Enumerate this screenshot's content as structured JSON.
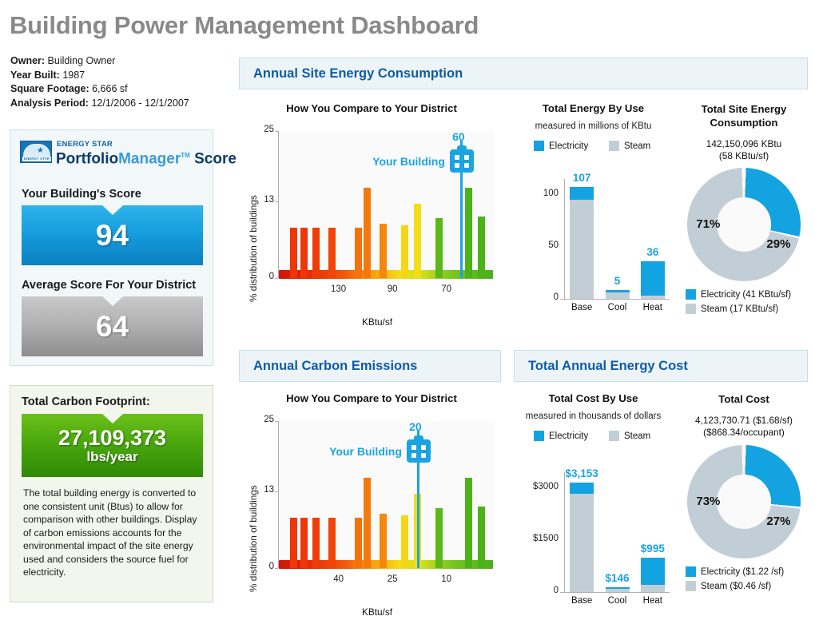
{
  "page": {
    "title": "Building Power Management Dashboard"
  },
  "meta": {
    "owner_label": "Owner:",
    "owner_value": "Building Owner",
    "year_label": "Year Built:",
    "year_value": "1987",
    "sqft_label": "Square Footage:",
    "sqft_value": "6,666 sf",
    "period_label": "Analysis Period:",
    "period_value": "12/1/2006 - 12/1/2007"
  },
  "score_panel": {
    "logo_top": "ENERGY STAR",
    "logo_mark_text": "ENERGY STAR",
    "logo_part1": "Portfolio",
    "logo_part2": "Manager",
    "logo_tm": "TM",
    "logo_part3": "Score",
    "building_score_label": "Your Building's Score",
    "building_score_value": "94",
    "district_score_label": "Average Score For Your District",
    "district_score_value": "64"
  },
  "carbon_panel": {
    "title": "Total Carbon Footprint:",
    "value": "27,109,373",
    "unit": "lbs/year",
    "description": "The total building energy is converted to one consistent unit (Btus) to allow for comparison with other buildings. Display of carbon emissions accounts for the environmental impact of the site energy used and considers the source fuel for electricity."
  },
  "sections": {
    "energy": "Annual Site Energy Consumption",
    "carbon": "Annual Carbon Emissions",
    "cost": "Total Annual Energy Cost"
  },
  "colors": {
    "electricity": "#13a3e0",
    "steam": "#c2ced5",
    "accent_blue": "#1ba4e2",
    "header_text": "#0d5ca8",
    "title_gray": "#898989",
    "carbon_green": "#4aa80d"
  },
  "chart_data": [
    {
      "id": "energy-histogram",
      "type": "bar",
      "title": "How You Compare to Your District",
      "xlabel": "KBtu/sf",
      "ylabel": "% distribution of buildings",
      "ylim": [
        0,
        25
      ],
      "yticks": [
        "0",
        "13",
        "25"
      ],
      "xticks": [
        "130",
        "90",
        "70"
      ],
      "xtick_positions": [
        0.28,
        0.53,
        0.78
      ],
      "marker_label": "Your Building",
      "marker_value": "60",
      "marker_position": 0.845,
      "bars": [
        {
          "pos": 0.055,
          "value": 8.6,
          "color": "#ee3707"
        },
        {
          "pos": 0.105,
          "value": 8.6,
          "color": "#ee3707"
        },
        {
          "pos": 0.16,
          "value": 8.6,
          "color": "#ef3d07"
        },
        {
          "pos": 0.235,
          "value": 8.6,
          "color": "#f04608"
        },
        {
          "pos": 0.355,
          "value": 8.6,
          "color": "#f4720b"
        },
        {
          "pos": 0.398,
          "value": 15.4,
          "color": "#f5780c"
        },
        {
          "pos": 0.47,
          "value": 9.2,
          "color": "#f5870d"
        },
        {
          "pos": 0.57,
          "value": 9.0,
          "color": "#f4d616"
        },
        {
          "pos": 0.63,
          "value": 12.6,
          "color": "#f2de18"
        },
        {
          "pos": 0.728,
          "value": 10.2,
          "color": "#5cb718"
        },
        {
          "pos": 0.865,
          "value": 15.4,
          "color": "#4bb217"
        },
        {
          "pos": 0.925,
          "value": 10.4,
          "color": "#4bb217"
        }
      ]
    },
    {
      "id": "energy-by-use",
      "type": "bar",
      "title": "Total Energy By Use",
      "subtitle": "measured in millions of KBtu",
      "ylim": [
        0,
        115
      ],
      "yticks": [
        "0",
        "50",
        "100"
      ],
      "categories": [
        "Base",
        "Cool",
        "Heat"
      ],
      "totals": [
        "107",
        "5",
        "36"
      ],
      "series": [
        {
          "name": "Electricity",
          "values": [
            12,
            1.6,
            33
          ]
        },
        {
          "name": "Steam",
          "values": [
            95,
            6.5,
            3
          ]
        }
      ],
      "legend": [
        "Electricity",
        "Steam"
      ]
    },
    {
      "id": "site-energy-donut",
      "type": "pie",
      "title": "Total Site Energy Consumption",
      "summary_line1": "142,150,096 KBtu",
      "summary_line2": "(58 KBtu/sf)",
      "labels": [
        "71%",
        "29%"
      ],
      "values": [
        71,
        29
      ],
      "legend": [
        "Electricity (41 KBtu/sf)",
        "Steam (17 KBtu/sf)"
      ]
    },
    {
      "id": "carbon-histogram",
      "type": "bar",
      "title": "How You Compare to Your District",
      "xlabel": "KBtu/sf",
      "ylabel": "% distribution of buildings",
      "ylim": [
        0,
        25
      ],
      "yticks": [
        "0",
        "13",
        "25"
      ],
      "xticks": [
        "40",
        "25",
        "10"
      ],
      "xtick_positions": [
        0.28,
        0.53,
        0.78
      ],
      "marker_label": "Your Building",
      "marker_value": "20",
      "marker_position": 0.645,
      "bars": [
        {
          "pos": 0.055,
          "value": 8.6,
          "color": "#ee3707"
        },
        {
          "pos": 0.105,
          "value": 8.6,
          "color": "#ee3707"
        },
        {
          "pos": 0.16,
          "value": 8.6,
          "color": "#ef3d07"
        },
        {
          "pos": 0.235,
          "value": 8.6,
          "color": "#f04608"
        },
        {
          "pos": 0.355,
          "value": 8.6,
          "color": "#f4720b"
        },
        {
          "pos": 0.398,
          "value": 15.4,
          "color": "#f5780c"
        },
        {
          "pos": 0.47,
          "value": 9.2,
          "color": "#f5870d"
        },
        {
          "pos": 0.57,
          "value": 9.0,
          "color": "#f4d616"
        },
        {
          "pos": 0.63,
          "value": 12.6,
          "color": "#f2de18"
        },
        {
          "pos": 0.728,
          "value": 10.2,
          "color": "#5cb718"
        },
        {
          "pos": 0.865,
          "value": 15.4,
          "color": "#4bb217"
        },
        {
          "pos": 0.925,
          "value": 10.4,
          "color": "#4bb217"
        }
      ]
    },
    {
      "id": "cost-by-use",
      "type": "bar",
      "title": "Total Cost By Use",
      "subtitle": "measured in thousands of dollars",
      "ylim": [
        0,
        3450
      ],
      "yticks": [
        "0",
        "$1500",
        "$3000"
      ],
      "categories": [
        "Base",
        "Cool",
        "Heat"
      ],
      "totals": [
        "$3,153",
        "$146",
        "$995"
      ],
      "series": [
        {
          "name": "Electricity",
          "values": [
            330,
            46,
            795
          ]
        },
        {
          "name": "Steam",
          "values": [
            2823,
            100,
            200
          ]
        }
      ],
      "legend": [
        "Electricity",
        "Steam"
      ]
    },
    {
      "id": "total-cost-donut",
      "type": "pie",
      "title": "Total Cost",
      "summary_line1": "4,123,730.71 ($1.68/sf)",
      "summary_line2": "($868.34/occupant)",
      "labels": [
        "73%",
        "27%"
      ],
      "values": [
        73,
        27
      ],
      "legend": [
        "Electricity ($1.22 /sf)",
        "Steam ($0.46 /sf)"
      ]
    }
  ]
}
